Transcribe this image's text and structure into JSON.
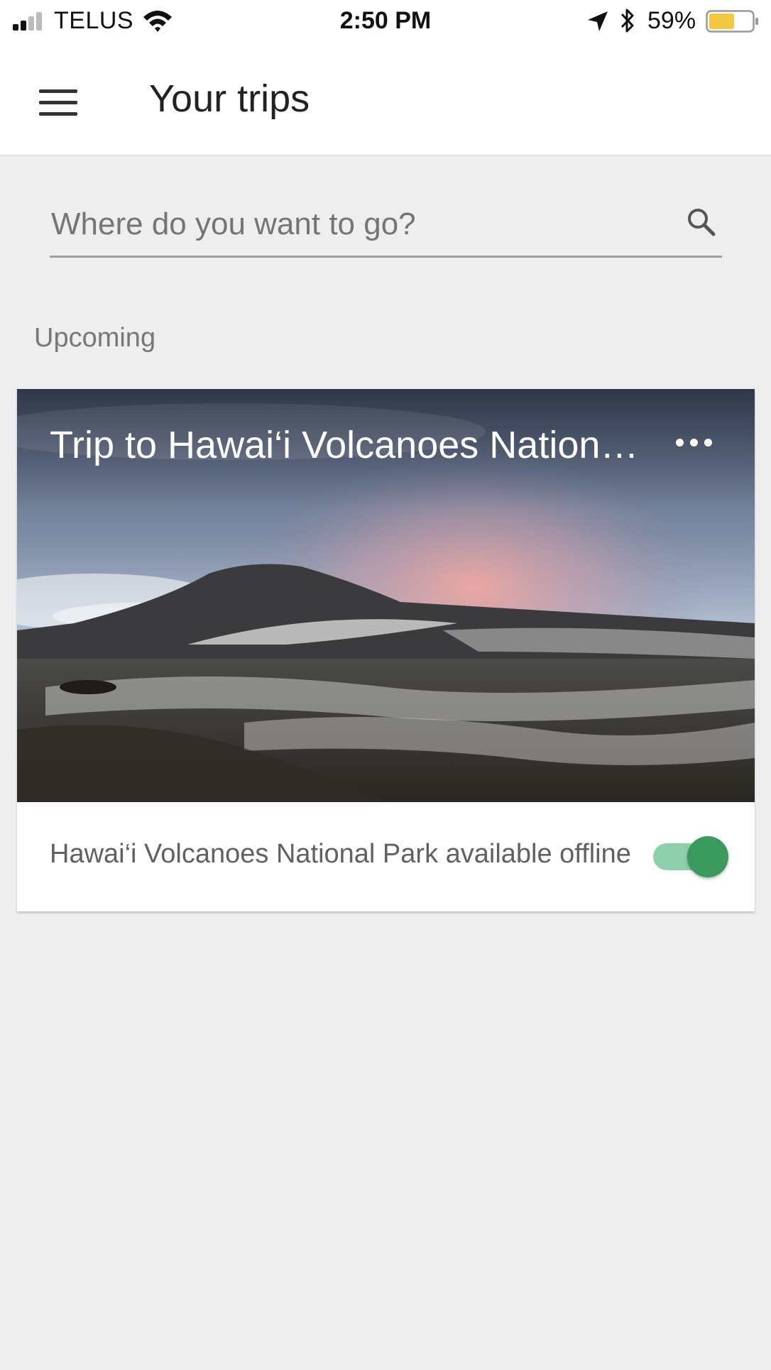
{
  "status_bar": {
    "carrier": "TELUS",
    "time": "2:50 PM",
    "battery_percent": "59%",
    "battery_level": 0.59,
    "battery_color": "#f4c842",
    "icons": [
      "signal-icon",
      "wifi-icon",
      "location-arrow-icon",
      "bluetooth-icon",
      "battery-icon"
    ]
  },
  "app_bar": {
    "title": "Your trips",
    "menu_icon": "hamburger-menu-icon"
  },
  "search": {
    "placeholder": "Where do you want to go?",
    "value": "",
    "icon": "search-icon"
  },
  "sections": {
    "upcoming_label": "Upcoming"
  },
  "trip_card": {
    "title": "Trip to Hawai‘i Volcanoes National Park",
    "more_icon": "more-horizontal-icon",
    "image_description_icon": "volcano-landscape-image",
    "offline_text": "Hawai‘i Volcanoes National Park available offline",
    "offline_toggle_on": true
  },
  "colors": {
    "accent_green": "#3a9a5e",
    "toggle_track": "#8fd0ab",
    "background": "#eeeeee"
  }
}
